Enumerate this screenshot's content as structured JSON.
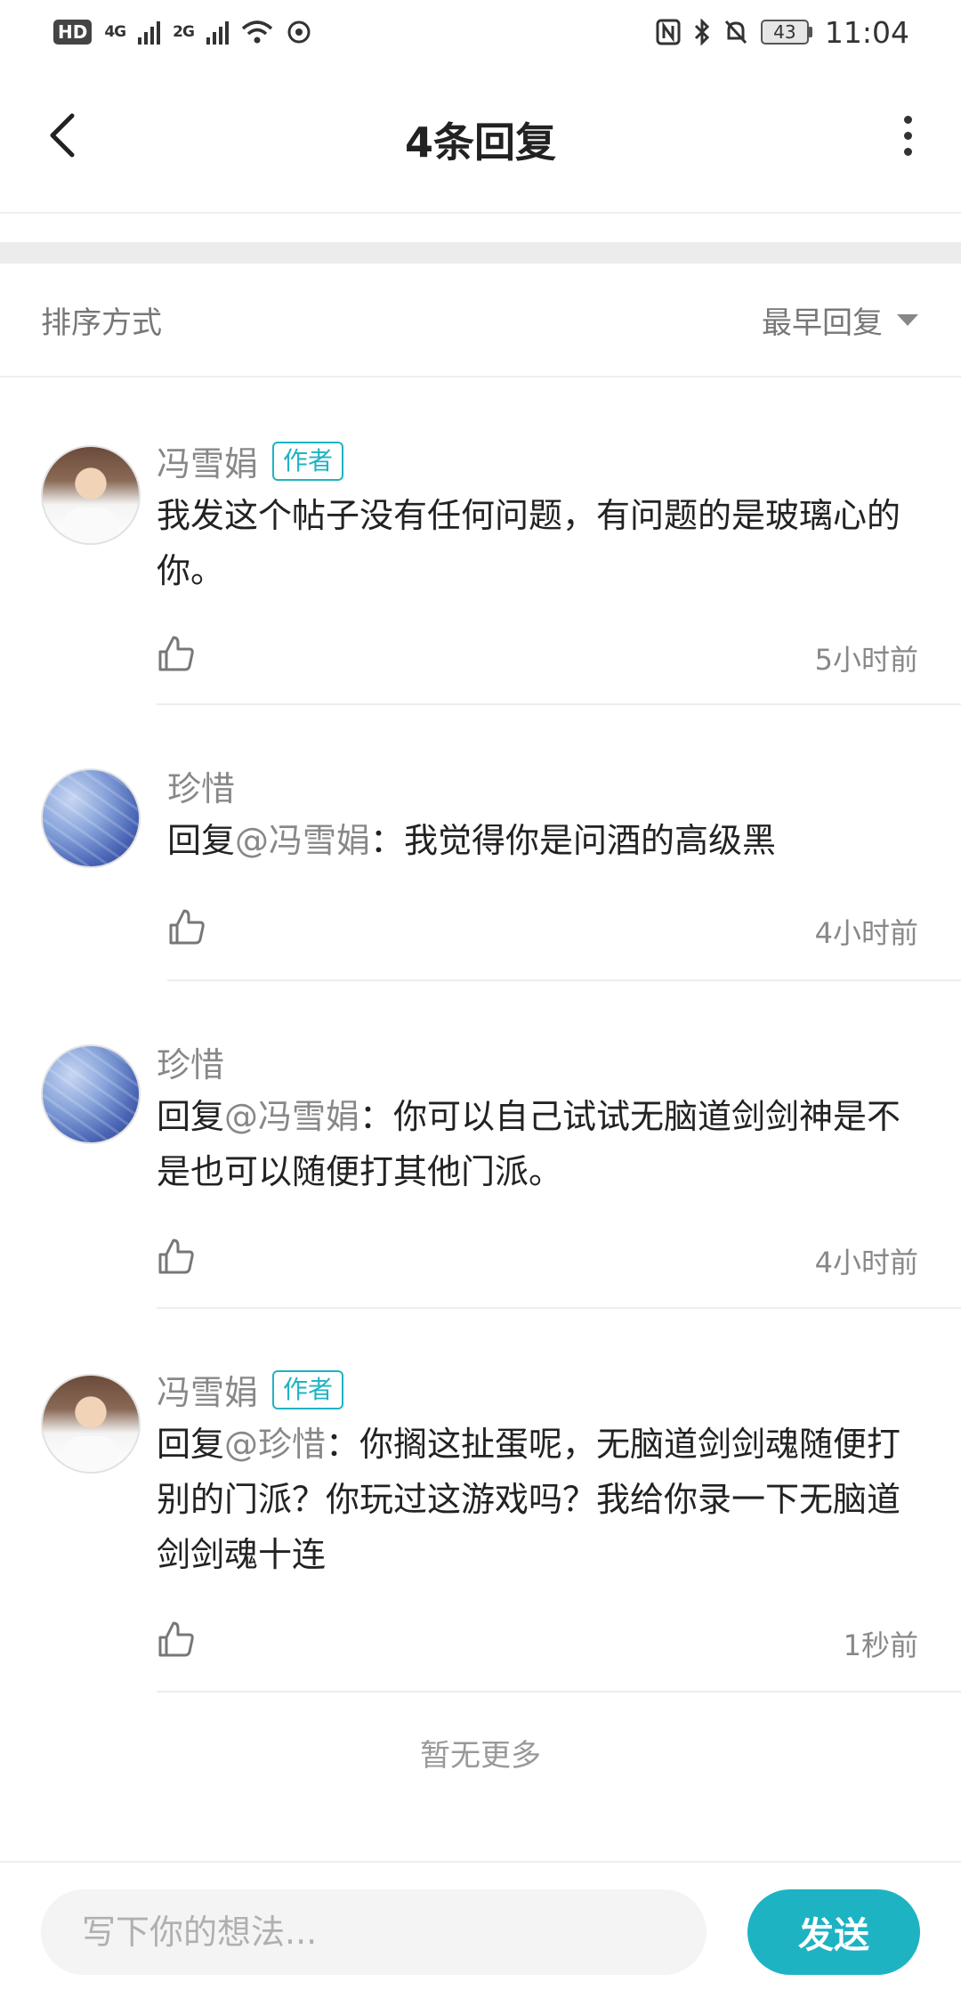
{
  "status_bar": {
    "hd": "HD",
    "signal1": "4G",
    "signal2": "2G",
    "battery": "43",
    "time": "11:04"
  },
  "header": {
    "title": "4条回复"
  },
  "sort": {
    "label": "排序方式",
    "selected": "最早回复"
  },
  "comments": [
    {
      "name": "冯雪娟",
      "badge": "作者",
      "reply_prefix": "",
      "mention": "",
      "text": "我发这个帖子没有任何问题，有问题的是玻璃心的你。",
      "time": "5小时前"
    },
    {
      "name": "珍惜",
      "reply_prefix": "回复",
      "mention": "@冯雪娟",
      "text": "：我觉得你是问酒的高级黑",
      "time": "4小时前"
    },
    {
      "name": "珍惜",
      "reply_prefix": "回复",
      "mention": "@冯雪娟",
      "text": "：你可以自己试试无脑道剑剑神是不是也可以随便打其他门派。",
      "time": "4小时前"
    },
    {
      "name": "冯雪娟",
      "badge": "作者",
      "reply_prefix": "回复",
      "mention": "@珍惜",
      "text": "：你搁这扯蛋呢，无脑道剑剑魂随便打别的门派？你玩过这游戏吗？我给你录一下无脑道剑剑魂十连",
      "time": "1秒前"
    }
  ],
  "footer": {
    "no_more": "暂无更多"
  },
  "input": {
    "placeholder": "写下你的想法...",
    "send_label": "发送"
  },
  "colors": {
    "accent": "#1eb3c3",
    "divider": "#eeeeee"
  }
}
